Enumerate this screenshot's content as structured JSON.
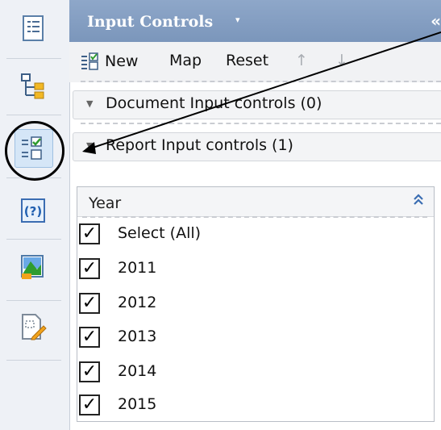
{
  "panel": {
    "title": "Input Controls",
    "title_caret": "▾",
    "collapse_glyph": "«"
  },
  "toolbar": {
    "new_label": "New",
    "map_label": "Map",
    "reset_label": "Reset",
    "move_up_glyph": "↑",
    "move_down_glyph": "↓"
  },
  "sections": {
    "document": {
      "label": "Document Input controls (0)",
      "triangle": "▼"
    },
    "report": {
      "label": "Report Input controls (1)",
      "triangle": "▼"
    }
  },
  "year_control": {
    "title": "Year",
    "collapse_glyph": "⌃",
    "items": [
      {
        "label": "Select (All)",
        "checked": "✓"
      },
      {
        "label": "2011",
        "checked": "✓"
      },
      {
        "label": "2012",
        "checked": "✓"
      },
      {
        "label": "2013",
        "checked": "✓"
      },
      {
        "label": "2014",
        "checked": "✓"
      },
      {
        "label": "2015",
        "checked": "✓"
      }
    ]
  },
  "sidebar": {
    "items": [
      {
        "icon": "document-structure-icon"
      },
      {
        "icon": "hierarchy-icon"
      },
      {
        "icon": "input-controls-icon",
        "active": true
      },
      {
        "icon": "help-icon",
        "text": "(?)"
      },
      {
        "icon": "chart-image-icon"
      },
      {
        "icon": "edit-document-icon"
      }
    ]
  },
  "colors": {
    "header_blue": "#7b96bb",
    "active_icon_bg": "#d5e6f7",
    "link_blue": "#3b6db2"
  }
}
